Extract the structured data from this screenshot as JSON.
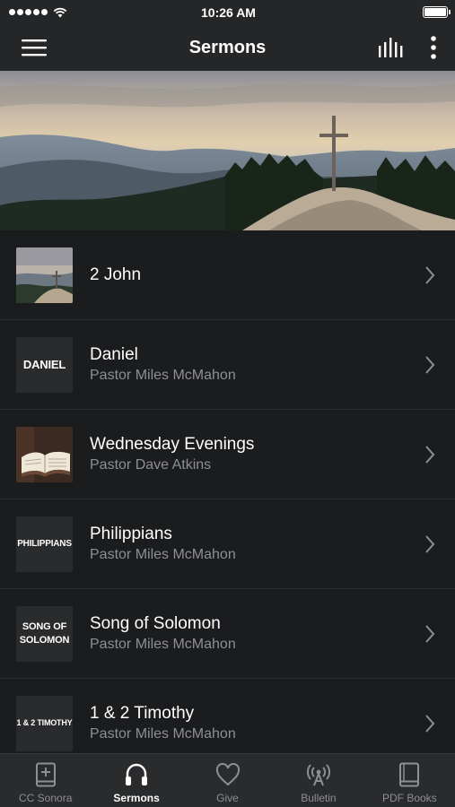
{
  "status_bar": {
    "time": "10:26 AM",
    "signal_dots": 5
  },
  "nav": {
    "title": "Sermons"
  },
  "sermons": [
    {
      "title": "2 John",
      "subtitle": "",
      "thumb_text": "",
      "thumb_kind": "landscape"
    },
    {
      "title": "Daniel",
      "subtitle": "Pastor Miles McMahon",
      "thumb_text": "DANIEL",
      "thumb_kind": "text"
    },
    {
      "title": "Wednesday Evenings",
      "subtitle": "Pastor Dave Atkins",
      "thumb_text": "",
      "thumb_kind": "bible"
    },
    {
      "title": "Philippians",
      "subtitle": "Pastor Miles McMahon",
      "thumb_text": "PHILIPPIANS",
      "thumb_kind": "text"
    },
    {
      "title": "Song of Solomon",
      "subtitle": "Pastor Miles McMahon",
      "thumb_text": "SONG OF SOLOMON",
      "thumb_kind": "text"
    },
    {
      "title": "1 & 2 Timothy",
      "subtitle": "Pastor Miles McMahon",
      "thumb_text": "1 & 2 TIMOTHY",
      "thumb_kind": "text"
    }
  ],
  "tabs": [
    {
      "label": "CC Sonora",
      "icon": "bible-plus-icon",
      "active": false
    },
    {
      "label": "Sermons",
      "icon": "headphones-icon",
      "active": true
    },
    {
      "label": "Give",
      "icon": "heart-icon",
      "active": false
    },
    {
      "label": "Bulletin",
      "icon": "broadcast-icon",
      "active": false
    },
    {
      "label": "PDF Books",
      "icon": "book-icon",
      "active": false
    }
  ],
  "colors": {
    "background": "#1b1c1e",
    "bar": "#252628",
    "tab_bar": "#2a2b2d",
    "muted_text": "#8e8f92",
    "active_tab": "#ffffff"
  }
}
